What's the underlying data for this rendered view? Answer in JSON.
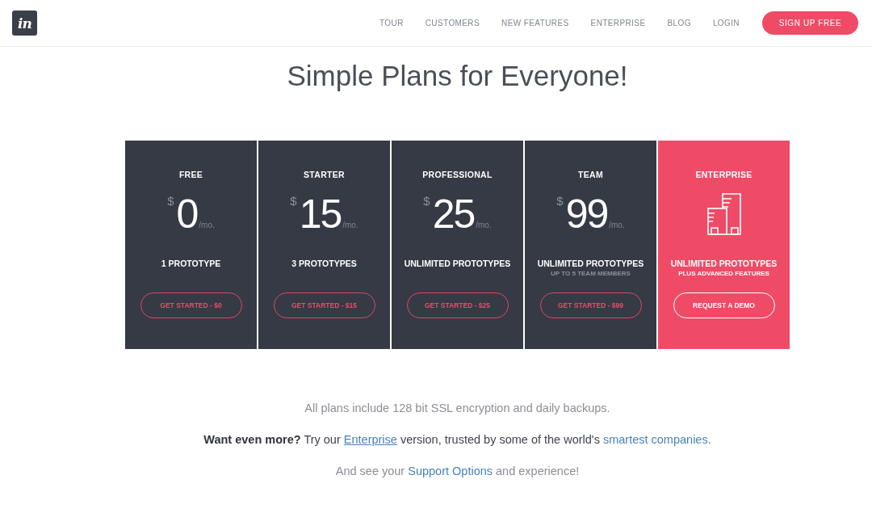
{
  "header": {
    "logo": "in",
    "nav": [
      "TOUR",
      "CUSTOMERS",
      "NEW FEATURES",
      "ENTERPRISE",
      "BLOG",
      "LOGIN"
    ],
    "cta": "SIGN UP FREE"
  },
  "title": "Simple Plans for Everyone!",
  "plans": [
    {
      "kind": "price",
      "name": "FREE",
      "currency": "$",
      "amount": "0",
      "period": "/mo.",
      "feature": "1 PROTOTYPE",
      "button": "GET STARTED - $0",
      "highlighted": false
    },
    {
      "kind": "price",
      "name": "STARTER",
      "currency": "$",
      "amount": "15",
      "period": "/mo.",
      "feature": "3 PROTOTYPES",
      "button": "GET STARTED - $15",
      "highlighted": false
    },
    {
      "kind": "price",
      "name": "PROFESSIONAL",
      "currency": "$",
      "amount": "25",
      "period": "/mo.",
      "feature": "UNLIMITED PROTOTYPES",
      "button": "GET STARTED - $25",
      "highlighted": false
    },
    {
      "kind": "price",
      "name": "TEAM",
      "currency": "$",
      "amount": "99",
      "period": "/mo.",
      "feature": "UNLIMITED PROTOTYPES",
      "subfeature": "UP TO 5 TEAM MEMBERS",
      "button": "GET STARTED - $99",
      "highlighted": false
    },
    {
      "kind": "icon",
      "name": "ENTERPRISE",
      "feature": "UNLIMITED PROTOTYPES",
      "subfeature": "PLUS ADVANCED FEATURES",
      "button": "REQUEST A DEMO",
      "highlighted": true
    }
  ],
  "notes": [
    {
      "kind": "muted",
      "parts": [
        {
          "kind": "text",
          "text": "All plans include 128 bit SSL encryption and daily backups."
        }
      ]
    },
    {
      "kind": "plain",
      "parts": [
        {
          "kind": "bold",
          "text": "Want even more?"
        },
        {
          "kind": "text",
          "text": " Try our "
        },
        {
          "kind": "link",
          "text": "Enterprise",
          "underlined": true
        },
        {
          "kind": "text",
          "text": " version, trusted by some of the world's "
        },
        {
          "kind": "link",
          "text": "smartest companies.",
          "underlined": false
        }
      ]
    },
    {
      "kind": "muted",
      "parts": [
        {
          "kind": "text",
          "text": "And see your "
        },
        {
          "kind": "link",
          "text": "Support Options",
          "underlined": false
        },
        {
          "kind": "text",
          "text": " and experience!"
        }
      ]
    }
  ]
}
